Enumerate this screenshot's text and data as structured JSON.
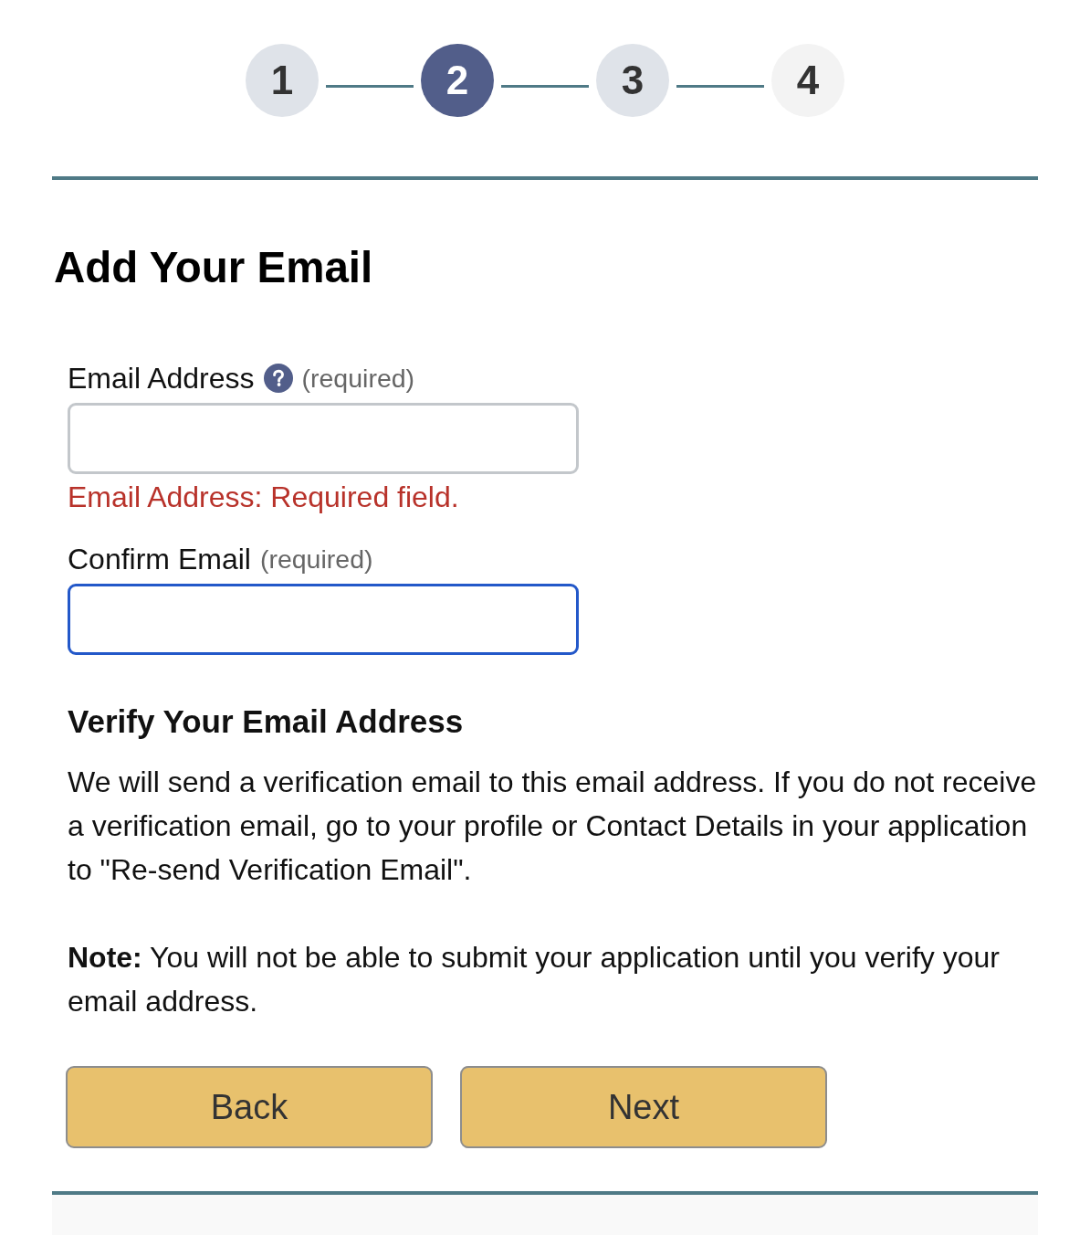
{
  "steps": [
    {
      "label": "1",
      "selected": false,
      "disabled": false
    },
    {
      "label": "2",
      "selected": true,
      "disabled": false
    },
    {
      "label": "3",
      "selected": false,
      "disabled": false
    },
    {
      "label": "4",
      "selected": false,
      "disabled": true
    }
  ],
  "title": "Add Your Email",
  "fields": [
    {
      "label": "Email Address",
      "help_icon": true,
      "hint": "(required)",
      "focused": false,
      "error": "Email Address: Required field."
    },
    {
      "label": "Confirm Email",
      "help_icon": false,
      "hint": "(required)",
      "focused": true
    }
  ],
  "verify": {
    "heading": "Verify Your Email Address",
    "paragraphs": [
      "We will send a verification email to this email address. If you do not receive a verification email, go to your profile or Contact Details in your application to \"Re-send Verification Email\".",
      "**Note:** You will not be able to submit your application until you verify your email address."
    ]
  },
  "buttons": [
    "Back",
    "Next"
  ]
}
